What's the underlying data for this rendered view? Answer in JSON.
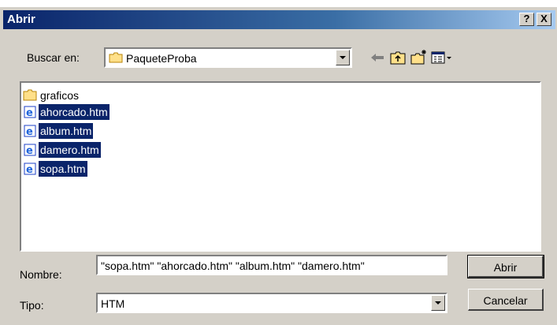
{
  "window": {
    "title": "Abrir"
  },
  "titlebar": {
    "help_label": "?",
    "close_label": "X"
  },
  "lookin": {
    "label": "Buscar en:",
    "value": "PaqueteProba"
  },
  "files": [
    {
      "name": "graficos",
      "icon": "folder-icon",
      "selected": false
    },
    {
      "name": "ahorcado.htm",
      "icon": "ie-document-icon",
      "selected": true
    },
    {
      "name": "album.htm",
      "icon": "ie-document-icon",
      "selected": true
    },
    {
      "name": "damero.htm",
      "icon": "ie-document-icon",
      "selected": true
    },
    {
      "name": "sopa.htm",
      "icon": "ie-document-icon",
      "selected": true
    }
  ],
  "filename": {
    "label": "Nombre:",
    "value": "\"sopa.htm\" \"ahorcado.htm\" \"album.htm\" \"damero.htm\""
  },
  "filetype": {
    "label": "Tipo:",
    "value": "HTM"
  },
  "buttons": {
    "open": "Abrir",
    "cancel": "Cancelar"
  },
  "colors": {
    "selection": "#0a246a",
    "face": "#d4d0c8",
    "title_start": "#0a246a"
  }
}
